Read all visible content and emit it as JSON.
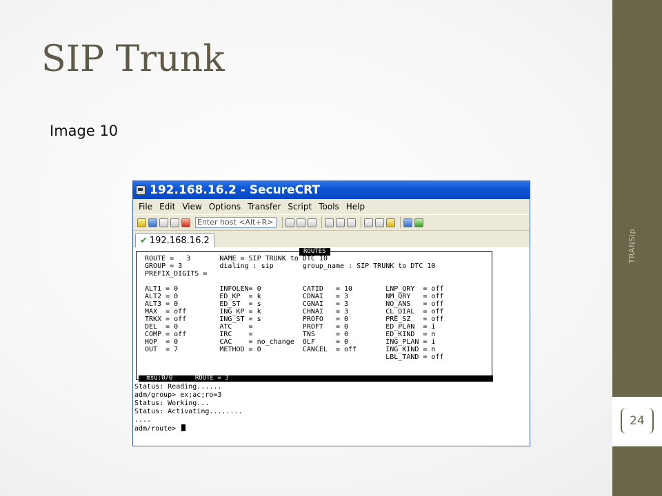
{
  "slide": {
    "title": "SIP Trunk",
    "subtitle": "Image 10",
    "side_label": "TRANSip",
    "page_number": "24",
    "colors": {
      "sidebar": "#6b6549",
      "title": "#5f5a48"
    }
  },
  "window": {
    "title": "192.168.16.2 - SecureCRT",
    "menu": [
      "File",
      "Edit",
      "View",
      "Options",
      "Transfer",
      "Script",
      "Tools",
      "Help"
    ],
    "host_placeholder": "Enter host <Alt+R>",
    "tab_label": "192.168.16.2"
  },
  "terminal": {
    "box_title": "ROUTES",
    "lines": [
      " ROUTE =   3       NAME = SIP TRUNK to DTC 10",
      " GROUP = 3         dialing : sip       group_name : SIP TRUNK to DTC 10",
      " PREFIX_DIGITS =",
      "",
      " ALT1 = 0          INFOLEN= 0          CATID   = 10        LNP_QRY  = off",
      " ALT2 = 0          ED_KP  = k          CDNAI   = 3         NM_QRY   = off",
      " ALT3 = 0          ED_ST  = s          CGNAI   = 3         NO_ANS   = off",
      " MAX  = off        ING_KP = k          CHNAI   = 3         CL_DIAL  = off",
      " TRKX = off        ING_ST = s          PROFO   = 0         PRE_SZ   = off",
      " DEL  = 0          ATC    =            PROFT   = 0         ED_PLAN  = i",
      " COMP = off        IRC    =            TNS     = 0         ED_KIND  = n",
      " HOP  = 0          CAC    = no_change  OLF     = 0         ING_PLAN = i",
      " OUT  = 7          METHOD = 0          CANCEL  = off       ING_KIND = n",
      "                                                           LBL_TAND = off"
    ],
    "status_bar": " msu:0/0      ROUTE = 3",
    "console_lines": [
      "Status: Reading......",
      "adm/group> ex;ac;ro=3",
      "Status: Working...",
      "Status: Activating........",
      "....",
      "adm/route> "
    ]
  }
}
